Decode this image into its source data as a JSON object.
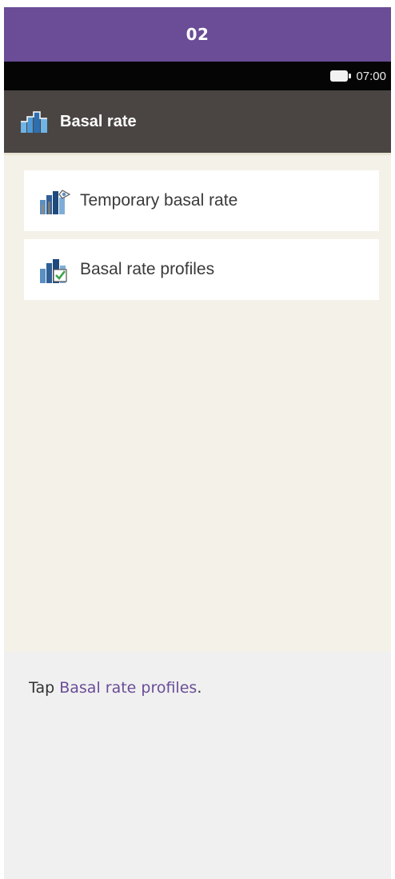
{
  "step": {
    "number": "02"
  },
  "status_bar": {
    "time": "07:00",
    "battery_icon": "battery-full-icon"
  },
  "title_bar": {
    "icon": "basal-rate-icon",
    "title": "Basal rate"
  },
  "menu": {
    "items": [
      {
        "label": "Temporary basal rate",
        "icon": "temporary-basal-rate-icon"
      },
      {
        "label": "Basal rate profiles",
        "icon": "basal-rate-profiles-icon"
      }
    ]
  },
  "instruction": {
    "prefix": "Tap ",
    "link": "Basal rate profiles",
    "suffix": "."
  },
  "colors": {
    "accent": "#6a4d96",
    "title_bar": "#4a4543",
    "screen_bg": "#f4f1e8",
    "caption_bg": "#f0f0f0"
  }
}
